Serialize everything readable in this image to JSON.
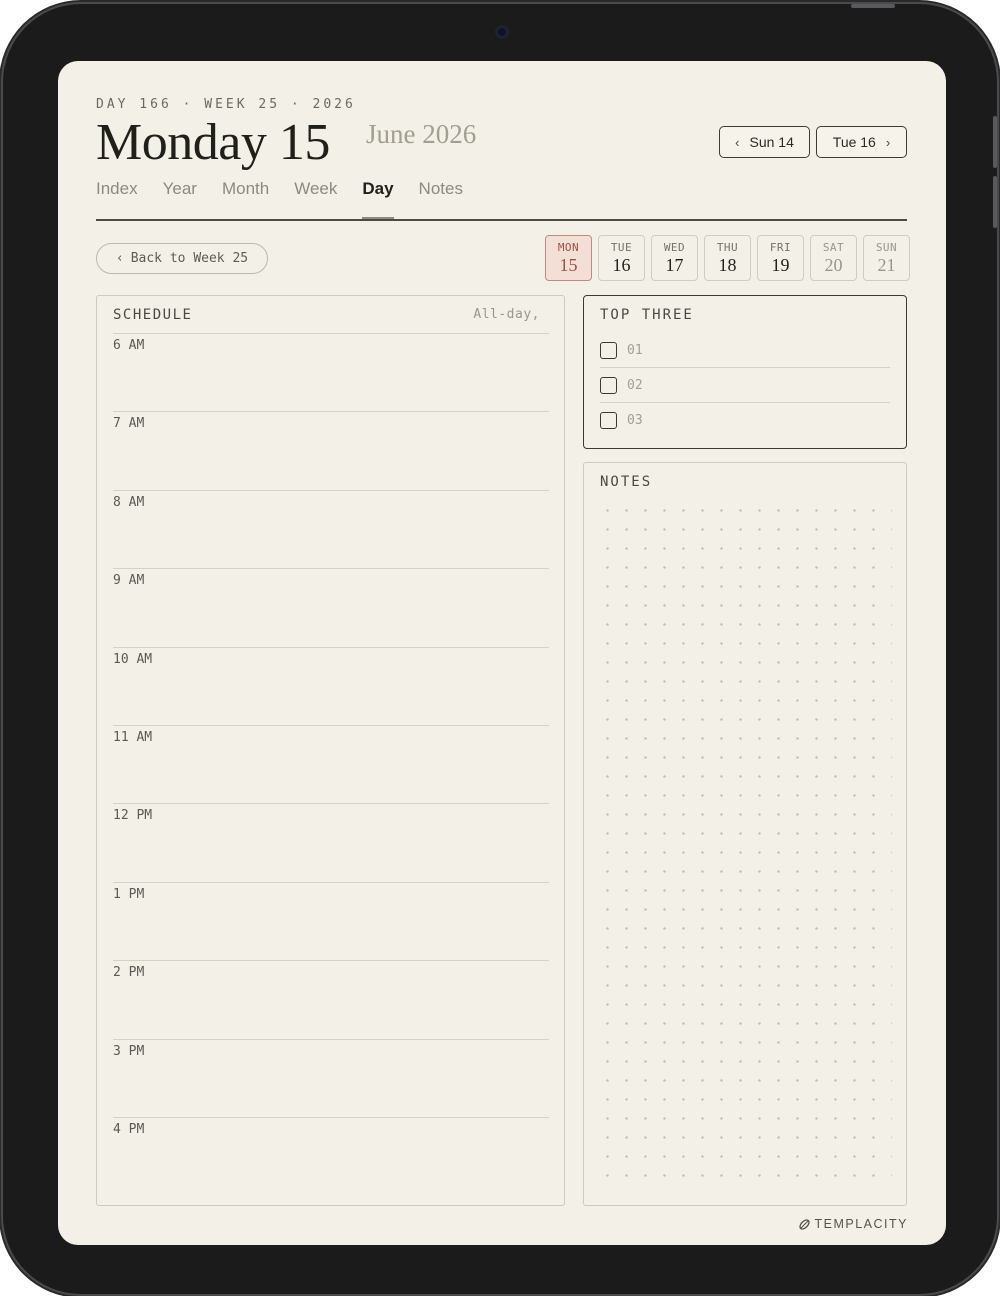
{
  "header": {
    "meta": "DAY 166 · WEEK 25 · 2026",
    "day_title": "Monday 15",
    "month_title": "June 2026",
    "prev_label": "Sun 14",
    "next_label": "Tue 16"
  },
  "tabs": [
    {
      "label": "Index"
    },
    {
      "label": "Year"
    },
    {
      "label": "Month"
    },
    {
      "label": "Week"
    },
    {
      "label": "Day"
    },
    {
      "label": "Notes"
    }
  ],
  "back_label": "Back to Week 25",
  "week_days": [
    {
      "name": "MON",
      "num": "15"
    },
    {
      "name": "TUE",
      "num": "16"
    },
    {
      "name": "WED",
      "num": "17"
    },
    {
      "name": "THU",
      "num": "18"
    },
    {
      "name": "FRI",
      "num": "19"
    },
    {
      "name": "SAT",
      "num": "20"
    },
    {
      "name": "SUN",
      "num": "21"
    }
  ],
  "schedule": {
    "title": "SCHEDULE",
    "allday": "All-day,",
    "hours": [
      "6 AM",
      "7 AM",
      "8 AM",
      "9 AM",
      "10 AM",
      "11 AM",
      "12 PM",
      "1 PM",
      "2 PM",
      "3 PM",
      "4 PM"
    ]
  },
  "top_three": {
    "title": "TOP THREE",
    "items": [
      "01",
      "02",
      "03"
    ]
  },
  "notes": {
    "title": "NOTES"
  },
  "brand": "TEMPLACITY",
  "colors": {
    "paper": "#f3f0e7",
    "accent": "#9e4f45",
    "accent_bg": "#f3dfd6",
    "ink": "#1f1f1c"
  }
}
